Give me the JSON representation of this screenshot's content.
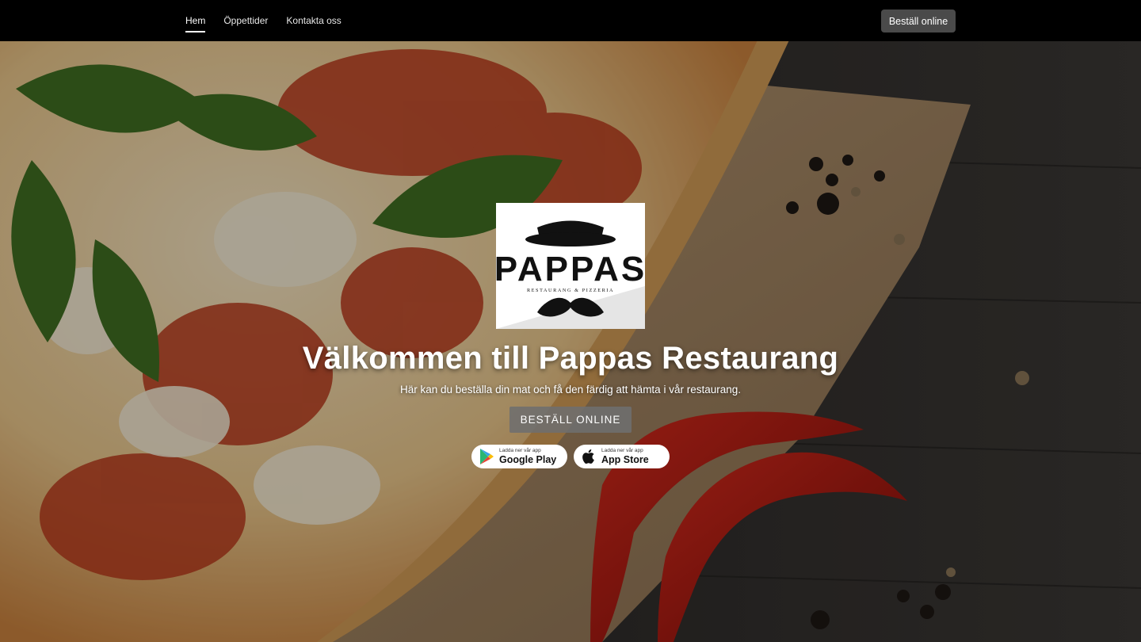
{
  "nav": {
    "items": [
      {
        "label": "Hem",
        "active": true
      },
      {
        "label": "Öppettider",
        "active": false
      },
      {
        "label": "Kontakta oss",
        "active": false
      }
    ],
    "order_button": "Beställ online"
  },
  "logo": {
    "name": "PAPPAS",
    "tagline": "RESTAURANG & PIZZERIA"
  },
  "hero": {
    "title": "Välkommen till Pappas Restaurang",
    "subtitle": "Här kan du beställa din mat och få den färdig att hämta i vår restaurang.",
    "cta": "BESTÄLL ONLINE"
  },
  "store_badges": [
    {
      "small": "Ladda ner vår app",
      "big": "Google Play",
      "icon": "google-play-icon"
    },
    {
      "small": "Ladda ner vår app",
      "big": "App Store",
      "icon": "apple-icon"
    }
  ],
  "colors": {
    "topbar": "#000000",
    "top_cta": "#4a4a4a",
    "hero_cta": "#6e6e6e"
  }
}
